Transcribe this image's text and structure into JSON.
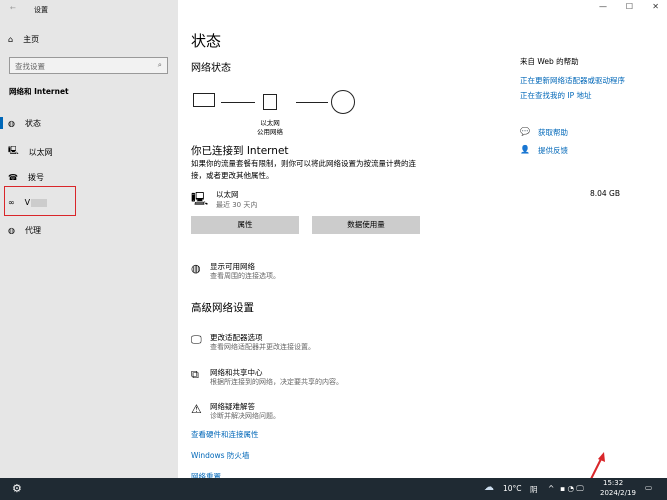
{
  "window": {
    "title": "设置",
    "minimize": "—",
    "maximize": "☐",
    "close": "✕"
  },
  "sidebar": {
    "home": "主页",
    "search_placeholder": "查找设置",
    "section": "网络和 Internet",
    "items": [
      {
        "label": "状态",
        "icon": "globe-icon"
      },
      {
        "label": "以太网",
        "icon": "ethernet-icon"
      },
      {
        "label": "拨号",
        "icon": "dialup-icon"
      },
      {
        "label": "V",
        "icon": "vpn-icon"
      },
      {
        "label": "代理",
        "icon": "globe-icon"
      }
    ]
  },
  "main": {
    "title": "状态",
    "network_status": "网络状态",
    "ethernet_label": "以太网",
    "network_label": "公用网络",
    "connected": "你已连接到 Internet",
    "connected_desc": "如果你的流量套餐有限制，则你可以将此网络设置为按流量计费的连接，或者更改其他属性。",
    "conn_name": "以太网",
    "conn_sub": "最近 30 天内",
    "conn_usage": "8.04 GB",
    "btn_properties": "属性",
    "btn_data_usage": "数据使用量",
    "show_networks": {
      "title": "显示可用网络",
      "sub": "查看周围的连接选项。"
    },
    "advanced": "高级网络设置",
    "adv_items": [
      {
        "title": "更改适配器选项",
        "sub": "查看网络适配器并更改连接设置。"
      },
      {
        "title": "网络和共享中心",
        "sub": "根据所连接到的网络，决定要共享的内容。"
      },
      {
        "title": "网络疑难解答",
        "sub": "诊断并解决网络问题。"
      }
    ],
    "links": [
      "查看硬件和连接属性",
      "Windows 防火墙",
      "网络重置"
    ]
  },
  "help": {
    "title": "来自 Web 的帮助",
    "links": [
      "正在更新网络适配器或驱动程序",
      "正在查找我的 IP 地址"
    ],
    "get_help": "获取帮助",
    "feedback": "提供反馈"
  },
  "taskbar": {
    "weather": "10°C",
    "weather_desc": "阴",
    "time": "15:32",
    "date": "2024/2/19"
  },
  "colors": {
    "accent": "#0067b8",
    "highlight": "#d9262a"
  }
}
